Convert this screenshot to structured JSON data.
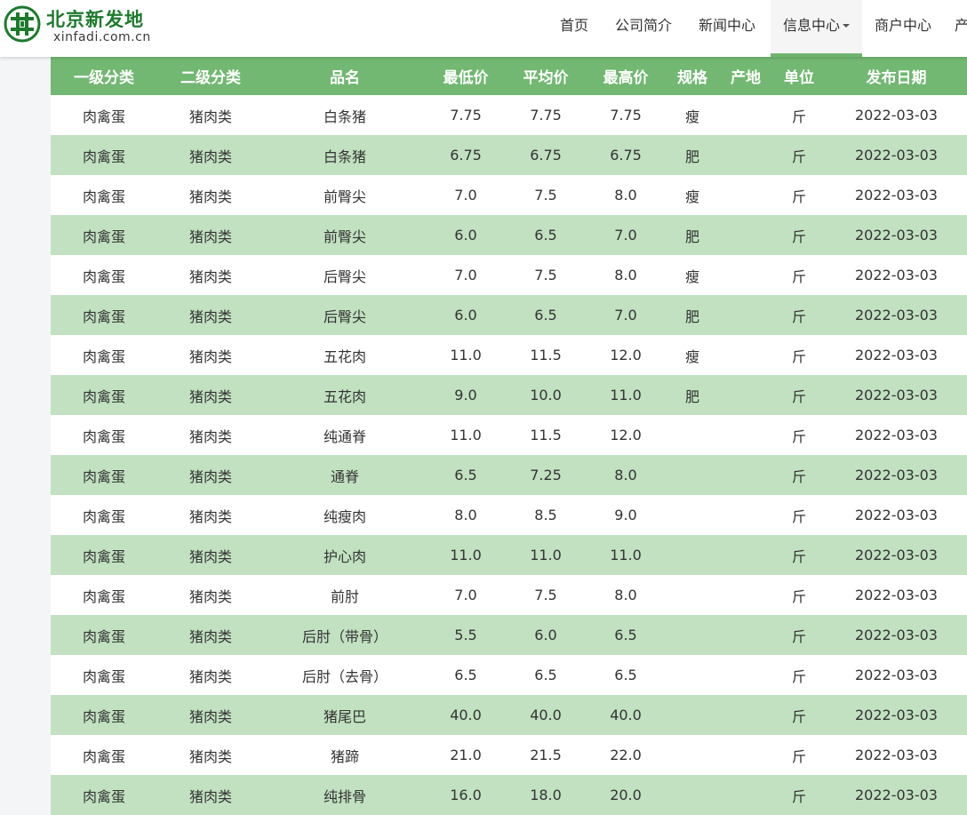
{
  "header": {
    "logo_cn": "北京新发地",
    "logo_en": "xinfadi.com.cn",
    "nav": [
      {
        "label": "首页"
      },
      {
        "label": "公司简介"
      },
      {
        "label": "新闻中心"
      },
      {
        "label": "信息中心",
        "dropdown": true,
        "active": true
      },
      {
        "label": "商户中心"
      },
      {
        "label": "产"
      }
    ]
  },
  "colors": {
    "brand_green": "#1c7a2c",
    "header_row": "#72b872",
    "stripe_row": "#c1e1c1",
    "active_underline": "#6fb56f"
  },
  "table": {
    "headers": [
      "一级分类",
      "二级分类",
      "品名",
      "最低价",
      "平均价",
      "最高价",
      "规格",
      "产地",
      "单位",
      "发布日期"
    ],
    "rows": [
      [
        "肉禽蛋",
        "猪肉类",
        "白条猪",
        "7.75",
        "7.75",
        "7.75",
        "瘦",
        "",
        "斤",
        "2022-03-03"
      ],
      [
        "肉禽蛋",
        "猪肉类",
        "白条猪",
        "6.75",
        "6.75",
        "6.75",
        "肥",
        "",
        "斤",
        "2022-03-03"
      ],
      [
        "肉禽蛋",
        "猪肉类",
        "前臀尖",
        "7.0",
        "7.5",
        "8.0",
        "瘦",
        "",
        "斤",
        "2022-03-03"
      ],
      [
        "肉禽蛋",
        "猪肉类",
        "前臀尖",
        "6.0",
        "6.5",
        "7.0",
        "肥",
        "",
        "斤",
        "2022-03-03"
      ],
      [
        "肉禽蛋",
        "猪肉类",
        "后臀尖",
        "7.0",
        "7.5",
        "8.0",
        "瘦",
        "",
        "斤",
        "2022-03-03"
      ],
      [
        "肉禽蛋",
        "猪肉类",
        "后臀尖",
        "6.0",
        "6.5",
        "7.0",
        "肥",
        "",
        "斤",
        "2022-03-03"
      ],
      [
        "肉禽蛋",
        "猪肉类",
        "五花肉",
        "11.0",
        "11.5",
        "12.0",
        "瘦",
        "",
        "斤",
        "2022-03-03"
      ],
      [
        "肉禽蛋",
        "猪肉类",
        "五花肉",
        "9.0",
        "10.0",
        "11.0",
        "肥",
        "",
        "斤",
        "2022-03-03"
      ],
      [
        "肉禽蛋",
        "猪肉类",
        "纯通脊",
        "11.0",
        "11.5",
        "12.0",
        "",
        "",
        "斤",
        "2022-03-03"
      ],
      [
        "肉禽蛋",
        "猪肉类",
        "通脊",
        "6.5",
        "7.25",
        "8.0",
        "",
        "",
        "斤",
        "2022-03-03"
      ],
      [
        "肉禽蛋",
        "猪肉类",
        "纯瘦肉",
        "8.0",
        "8.5",
        "9.0",
        "",
        "",
        "斤",
        "2022-03-03"
      ],
      [
        "肉禽蛋",
        "猪肉类",
        "护心肉",
        "11.0",
        "11.0",
        "11.0",
        "",
        "",
        "斤",
        "2022-03-03"
      ],
      [
        "肉禽蛋",
        "猪肉类",
        "前肘",
        "7.0",
        "7.5",
        "8.0",
        "",
        "",
        "斤",
        "2022-03-03"
      ],
      [
        "肉禽蛋",
        "猪肉类",
        "后肘（带骨）",
        "5.5",
        "6.0",
        "6.5",
        "",
        "",
        "斤",
        "2022-03-03"
      ],
      [
        "肉禽蛋",
        "猪肉类",
        "后肘（去骨）",
        "6.5",
        "6.5",
        "6.5",
        "",
        "",
        "斤",
        "2022-03-03"
      ],
      [
        "肉禽蛋",
        "猪肉类",
        "猪尾巴",
        "40.0",
        "40.0",
        "40.0",
        "",
        "",
        "斤",
        "2022-03-03"
      ],
      [
        "肉禽蛋",
        "猪肉类",
        "猪蹄",
        "21.0",
        "21.5",
        "22.0",
        "",
        "",
        "斤",
        "2022-03-03"
      ],
      [
        "肉禽蛋",
        "猪肉类",
        "纯排骨",
        "16.0",
        "18.0",
        "20.0",
        "",
        "",
        "斤",
        "2022-03-03"
      ]
    ]
  }
}
